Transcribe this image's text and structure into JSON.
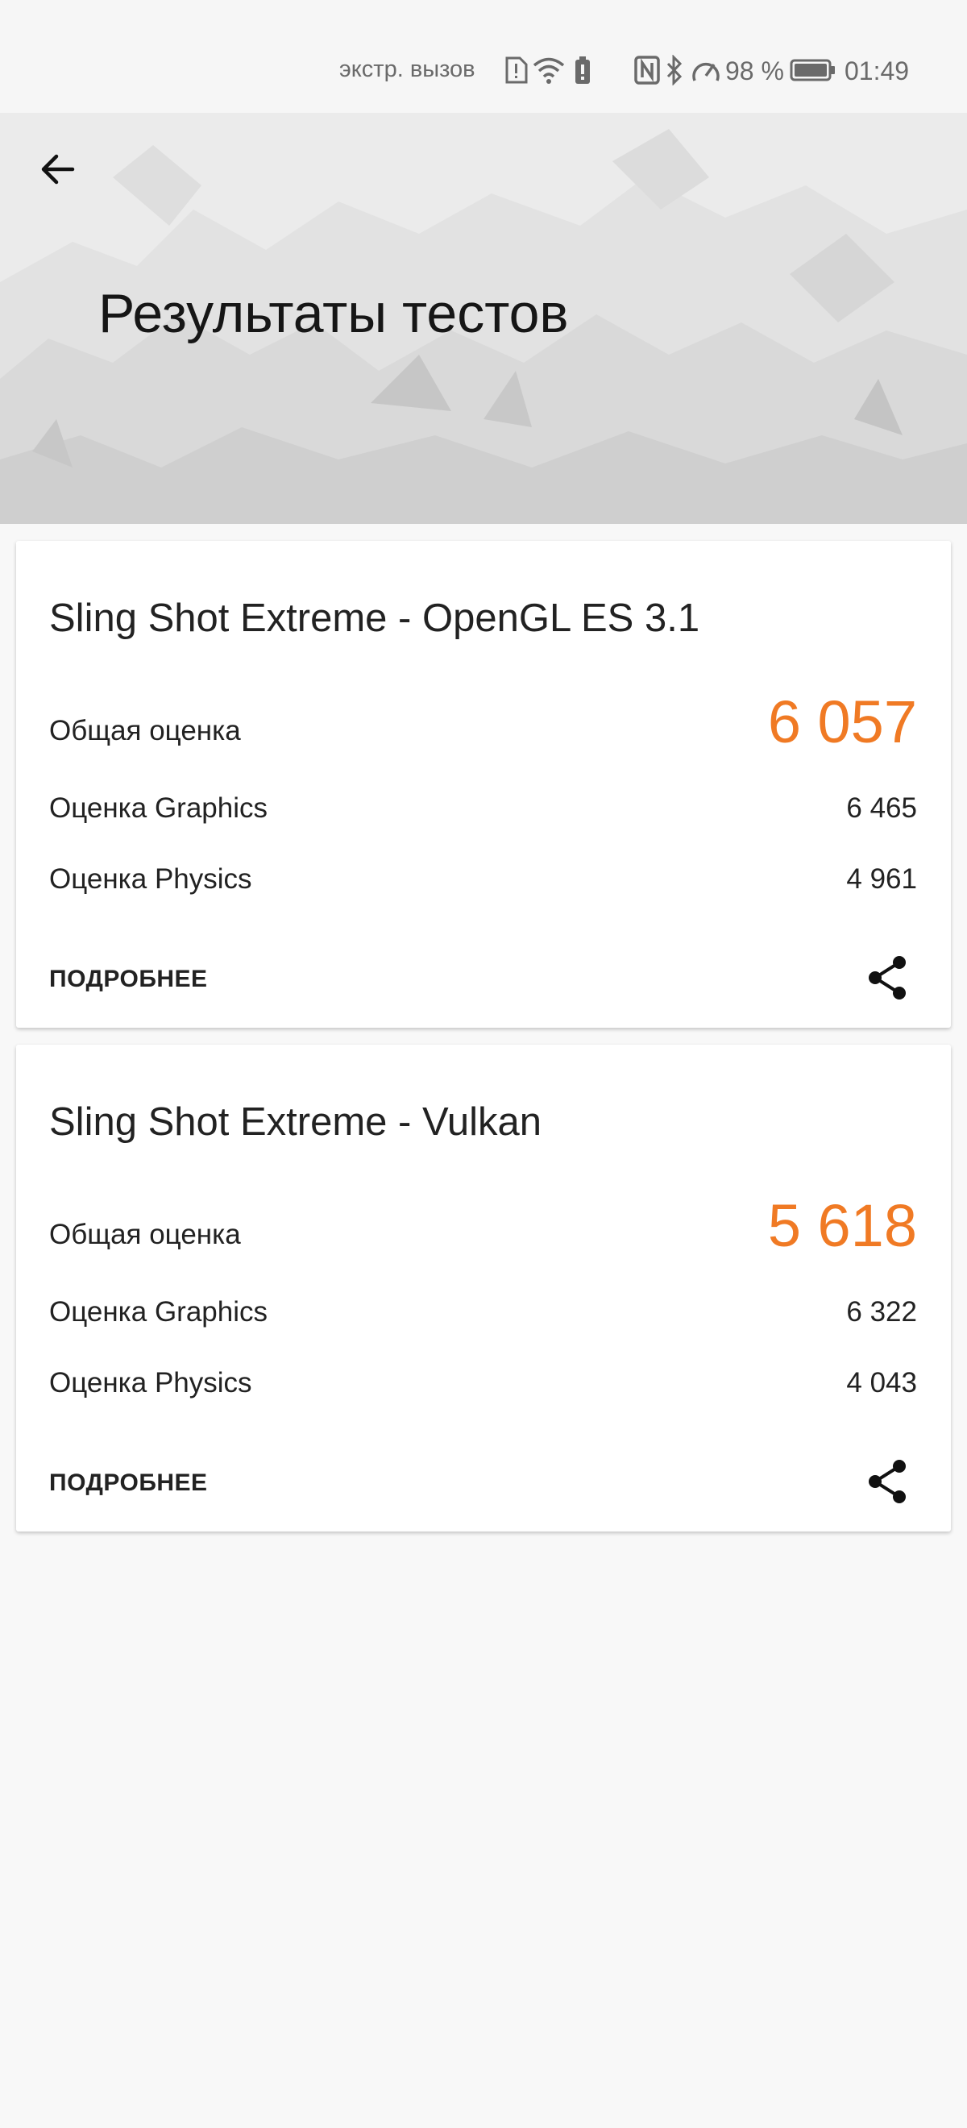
{
  "status_bar": {
    "emergency_text": "экстр. вызов",
    "battery_percent": "98 %",
    "time": "01:49",
    "icons": [
      "sim-alert-icon",
      "wifi-icon",
      "battery-saver-icon",
      "nfc-icon",
      "bluetooth-icon",
      "speed-icon",
      "battery-icon"
    ]
  },
  "header": {
    "title": "Результаты тестов",
    "back_icon": "arrow-back-icon"
  },
  "results": [
    {
      "test_name": "Sling Shot Extreme - OpenGL ES 3.1",
      "total_label": "Общая оценка",
      "total_score": "6 057",
      "graphics_label": "Оценка Graphics",
      "graphics_score": "6 465",
      "physics_label": "Оценка Physics",
      "physics_score": "4 961",
      "details_label": "ПОДРОБНЕЕ",
      "share_icon": "share-icon"
    },
    {
      "test_name": "Sling Shot Extreme - Vulkan",
      "total_label": "Общая оценка",
      "total_score": "5 618",
      "graphics_label": "Оценка Graphics",
      "graphics_score": "6 322",
      "physics_label": "Оценка Physics",
      "physics_score": "4 043",
      "details_label": "ПОДРОБНЕЕ",
      "share_icon": "share-icon"
    }
  ],
  "colors": {
    "accent_score": "#f07a24",
    "background": "#f8f8f8",
    "card": "#ffffff"
  }
}
